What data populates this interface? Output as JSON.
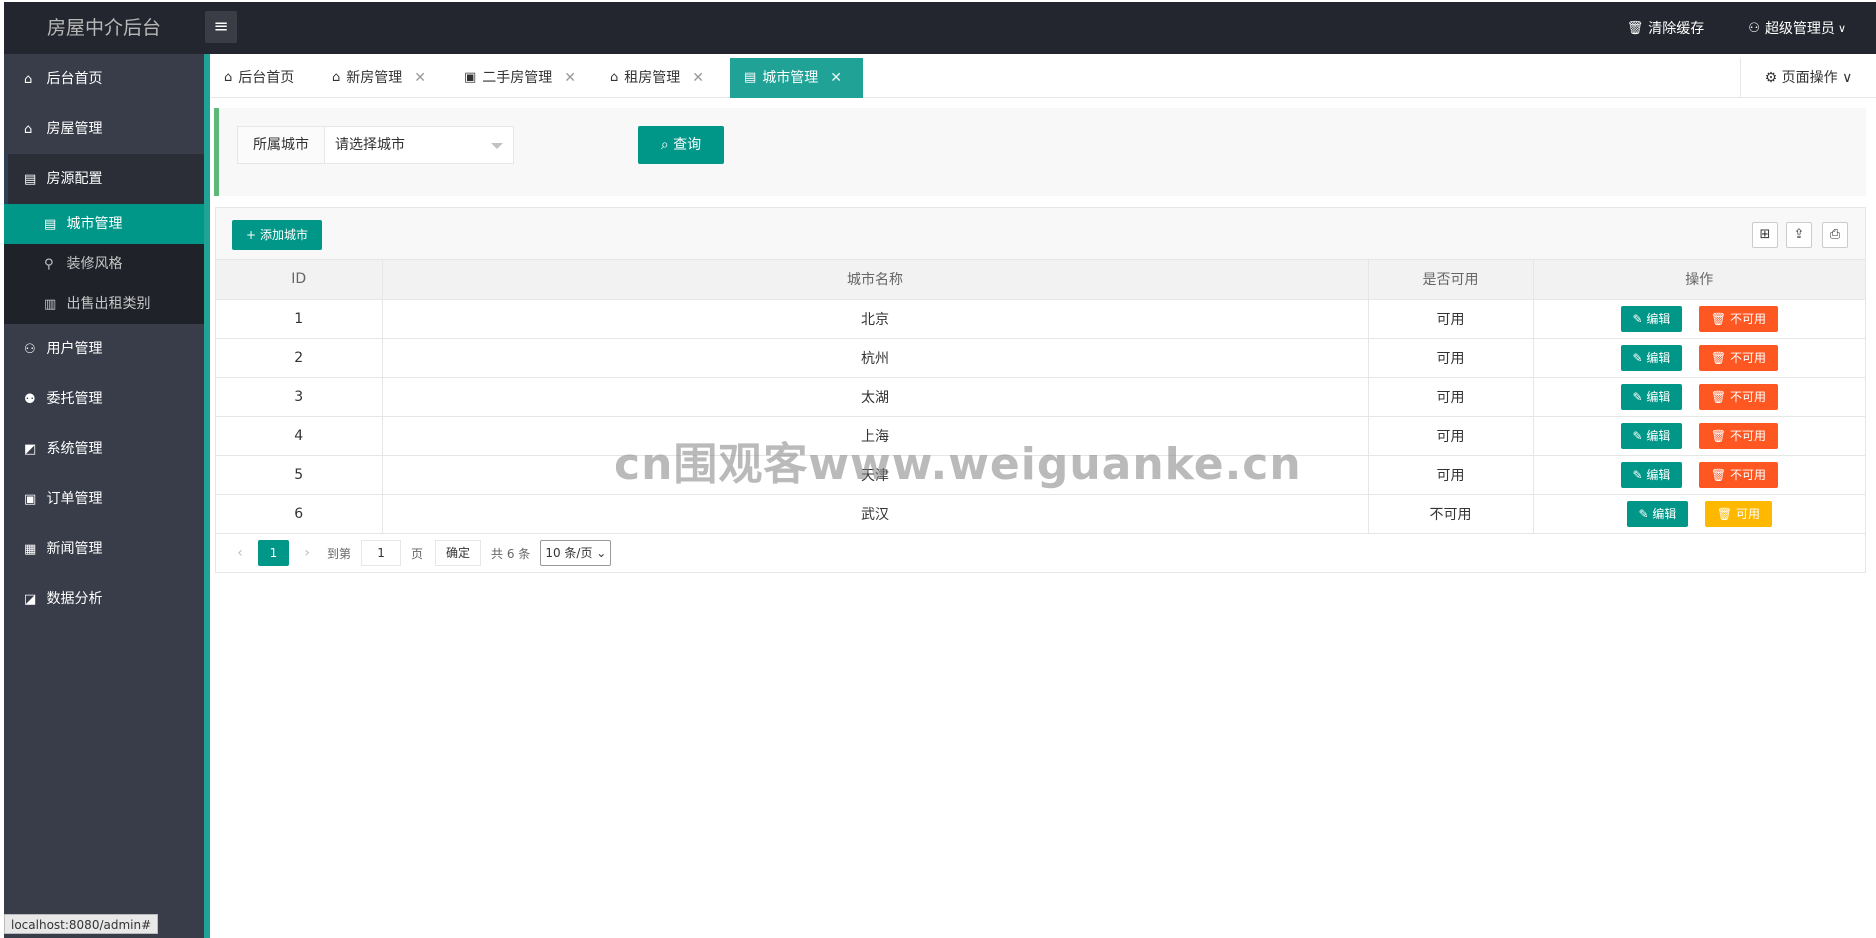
{
  "app": {
    "title": "房屋中介后台"
  },
  "header": {
    "menu_icon": "hamburger-icon",
    "clear_cache": "清除缓存",
    "admin": "超级管理员"
  },
  "sidebar": {
    "items": [
      {
        "label": "后台首页",
        "icon": "home-icon"
      },
      {
        "label": "房屋管理",
        "icon": "house-icon"
      },
      {
        "label": "房源配置",
        "icon": "building-icon"
      },
      {
        "label": "用户管理",
        "icon": "user-icon"
      },
      {
        "label": "委托管理",
        "icon": "delegate-icon"
      },
      {
        "label": "系统管理",
        "icon": "system-icon"
      },
      {
        "label": "订单管理",
        "icon": "order-icon"
      },
      {
        "label": "新闻管理",
        "icon": "news-icon"
      },
      {
        "label": "数据分析",
        "icon": "chart-icon"
      }
    ],
    "sub_items": [
      {
        "label": "城市管理"
      },
      {
        "label": "装修风格"
      },
      {
        "label": "出售出租类别"
      }
    ]
  },
  "tabs": [
    {
      "label": "后台首页"
    },
    {
      "label": "新房管理"
    },
    {
      "label": "二手房管理"
    },
    {
      "label": "租房管理"
    },
    {
      "label": "城市管理"
    }
  ],
  "page_ops": "页面操作",
  "search": {
    "label": "所属城市",
    "placeholder": "请选择城市",
    "button": "查询"
  },
  "toolbar": {
    "add_button": "添加城市"
  },
  "table": {
    "headers": [
      "ID",
      "城市名称",
      "是否可用",
      "操作"
    ],
    "rows": [
      {
        "id": "1",
        "name": "北京",
        "status": "可用",
        "edit": "编辑",
        "toggle": "不可用"
      },
      {
        "id": "2",
        "name": "杭州",
        "status": "可用",
        "edit": "编辑",
        "toggle": "不可用"
      },
      {
        "id": "3",
        "name": "太湖",
        "status": "可用",
        "edit": "编辑",
        "toggle": "不可用"
      },
      {
        "id": "4",
        "name": "上海",
        "status": "可用",
        "edit": "编辑",
        "toggle": "不可用"
      },
      {
        "id": "5",
        "name": "天津",
        "status": "可用",
        "edit": "编辑",
        "toggle": "不可用"
      },
      {
        "id": "6",
        "name": "武汉",
        "status": "不可用",
        "edit": "编辑",
        "toggle": "可用"
      }
    ]
  },
  "pager": {
    "current": "1",
    "goto_label": "到第",
    "goto_value": "1",
    "page_label": "页",
    "confirm": "确定",
    "total": "共 6 条",
    "page_size": "10 条/页"
  },
  "watermark": "cn围观客www.weiguanke.cn",
  "status_url": "localhost:8080/admin#",
  "colors": {
    "accent": "#009688",
    "header_bg": "#23262e",
    "sidebar_bg": "#393d49",
    "danger": "#ff5722",
    "warn": "#ffb800"
  }
}
